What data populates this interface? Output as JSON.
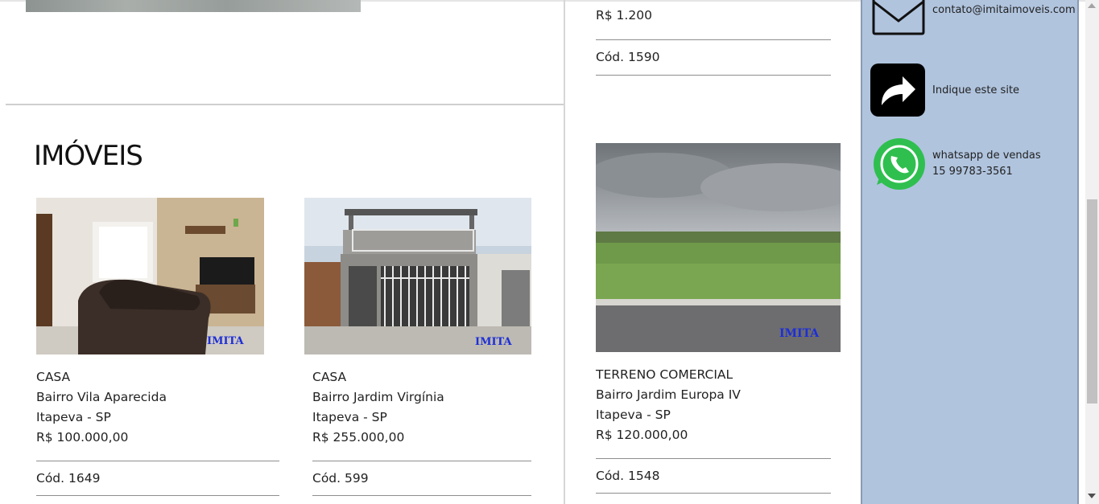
{
  "section": {
    "title": "IMÓVEIS"
  },
  "partial_listing": {
    "price": "R$ 1.200",
    "code": "Cód. 1590"
  },
  "listings": [
    {
      "type": "CASA",
      "neighborhood": "Bairro Vila Aparecida",
      "city": "Itapeva - SP",
      "price": "R$ 100.000,00",
      "code": "Cód. 1649",
      "watermark": "IMITA"
    },
    {
      "type": "CASA",
      "neighborhood": "Bairro Jardim Virgínia",
      "city": "Itapeva - SP",
      "price": "R$ 255.000,00",
      "code": "Cód. 599",
      "watermark": "IMITA"
    },
    {
      "type": "TERRENO COMERCIAL",
      "neighborhood": "Bairro Jardim Europa IV",
      "city": "Itapeva - SP",
      "price": "R$ 120.000,00",
      "code": "Cód. 1548",
      "watermark": "IMITA"
    }
  ],
  "sidebar": {
    "email": {
      "icon": "envelope-icon",
      "text": "contato@imitaimoveis.com"
    },
    "share": {
      "icon": "share-arrow-icon",
      "text": "Indique este site"
    },
    "whatsapp": {
      "icon": "whatsapp-icon",
      "label": "whatsapp de vendas",
      "phone": "15 99783-3561"
    },
    "background_color": "#b0c4de"
  }
}
